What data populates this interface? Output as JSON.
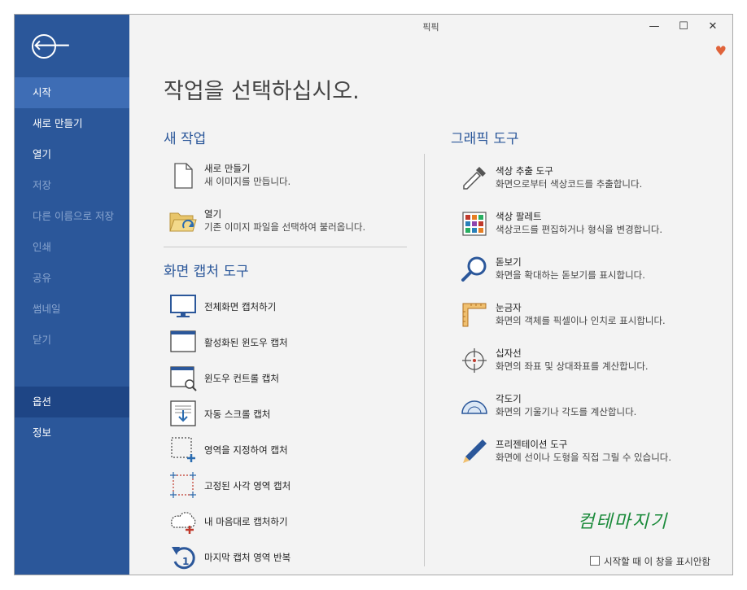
{
  "window": {
    "title": "픽픽"
  },
  "window_controls": {
    "minimize": "—",
    "maximize": "☐",
    "close": "✕"
  },
  "sidebar": {
    "back": "🡐",
    "items": [
      {
        "label": "시작",
        "state": "active"
      },
      {
        "label": "새로 만들기",
        "state": "normal"
      },
      {
        "label": "열기",
        "state": "normal"
      },
      {
        "label": "저장",
        "state": "disabled"
      },
      {
        "label": "다른 이름으로 저장",
        "state": "disabled"
      },
      {
        "label": "인쇄",
        "state": "disabled"
      },
      {
        "label": "공유",
        "state": "disabled"
      },
      {
        "label": "썸네일",
        "state": "disabled"
      },
      {
        "label": "닫기",
        "state": "disabled"
      },
      {
        "label": "옵션",
        "state": "selected"
      },
      {
        "label": "정보",
        "state": "normal"
      }
    ]
  },
  "main": {
    "heading": "작업을 선택하십시오.",
    "new_task": {
      "title": "새 작업",
      "items": [
        {
          "title": "새로 만들기",
          "desc": "새 이미지를 만듭니다.",
          "icon": "new-document-icon"
        },
        {
          "title": "열기",
          "desc": "기존 이미지 파일을 선택하여 불러옵니다.",
          "icon": "open-folder-icon"
        }
      ]
    },
    "capture": {
      "title": "화면 캡처 도구",
      "items": [
        {
          "title": "전체화면 캡처하기",
          "icon": "monitor-icon"
        },
        {
          "title": "활성화된 윈도우 캡처",
          "icon": "active-window-icon"
        },
        {
          "title": "윈도우 컨트롤 캡처",
          "icon": "window-control-icon"
        },
        {
          "title": "자동 스크롤 캡처",
          "icon": "scroll-capture-icon"
        },
        {
          "title": "영역을 지정하여 캡처",
          "icon": "region-select-icon"
        },
        {
          "title": "고정된 사각 영역 캡처",
          "icon": "fixed-region-icon"
        },
        {
          "title": "내 마음대로 캡처하기",
          "icon": "freehand-capture-icon"
        },
        {
          "title": "마지막 캡처 영역 반복",
          "icon": "repeat-icon"
        }
      ]
    },
    "graphics": {
      "title": "그래픽 도구",
      "items": [
        {
          "title": "색상 추출 도구",
          "desc": "화면으로부터 색상코드를 추출합니다.",
          "icon": "eyedropper-icon"
        },
        {
          "title": "색상 팔레트",
          "desc": "색상코드를 편집하거나 형식을 변경합니다.",
          "icon": "palette-icon"
        },
        {
          "title": "돋보기",
          "desc": "화면을 확대하는 돋보기를 표시합니다.",
          "icon": "magnifier-icon"
        },
        {
          "title": "눈금자",
          "desc": "화면의 객체를 픽셀이나 인치로 표시합니다.",
          "icon": "ruler-icon"
        },
        {
          "title": "십자선",
          "desc": "화면의 좌표 및 상대좌표를 계산합니다.",
          "icon": "crosshair-icon"
        },
        {
          "title": "각도기",
          "desc": "화면의 기울기나 각도를 계산합니다.",
          "icon": "protractor-icon"
        },
        {
          "title": "프리젠테이션 도구",
          "desc": "화면에 선이나 도형을 직접 그릴 수 있습니다.",
          "icon": "pen-icon"
        }
      ]
    }
  },
  "footer": {
    "dont_show": "시작할 때 이 창을 표시안함",
    "checked": false
  },
  "watermark": "컴테마지기",
  "colors": {
    "sidebar": "#2b579a",
    "sidebar_active": "#3e6db5",
    "sidebar_selected": "#1e4585",
    "accent": "#2b579a",
    "heart": "#e0633a",
    "watermark": "#1a8a3a"
  }
}
